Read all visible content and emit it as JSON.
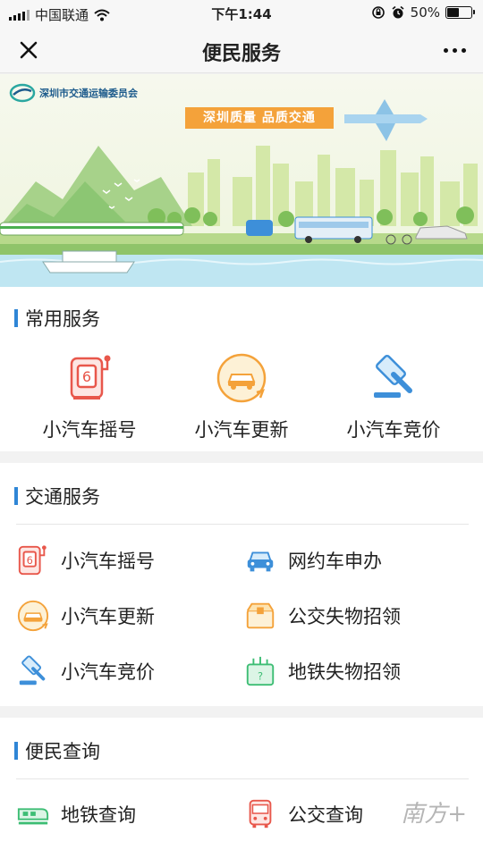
{
  "status_bar": {
    "carrier": "中国联通",
    "time": "下午1:44",
    "battery_percent": "50%",
    "battery_level": 0.5
  },
  "nav": {
    "title": "便民服务",
    "close_icon": "close-icon",
    "more_icon": "more-dots-icon"
  },
  "banner": {
    "org_name": "深圳市交通运输委员会",
    "slogan": "深圳质量  品质交通"
  },
  "common_services": {
    "title": "常用服务",
    "items": [
      {
        "label": "小汽车摇号",
        "icon": "lottery-machine-icon"
      },
      {
        "label": "小汽车更新",
        "icon": "car-renew-icon"
      },
      {
        "label": "小汽车竞价",
        "icon": "auction-hammer-icon"
      }
    ]
  },
  "traffic_services": {
    "title": "交通服务",
    "items": [
      {
        "label": "小汽车摇号",
        "icon": "lottery-machine-icon"
      },
      {
        "label": "网约车申办",
        "icon": "car-icon"
      },
      {
        "label": "小汽车更新",
        "icon": "car-renew-icon"
      },
      {
        "label": "公交失物招领",
        "icon": "lost-box-icon"
      },
      {
        "label": "小汽车竞价",
        "icon": "auction-hammer-icon"
      },
      {
        "label": "地铁失物招领",
        "icon": "lost-bag-icon"
      }
    ]
  },
  "query_services": {
    "title": "便民查询",
    "items": [
      {
        "label": "地铁查询",
        "icon": "metro-train-icon"
      },
      {
        "label": "公交查询",
        "icon": "bus-icon"
      }
    ]
  },
  "colors": {
    "accent": "#2f86d6",
    "orange": "#f4a23a",
    "red": "#e8574b",
    "green": "#3dbd74",
    "blue": "#3d8fd9"
  }
}
